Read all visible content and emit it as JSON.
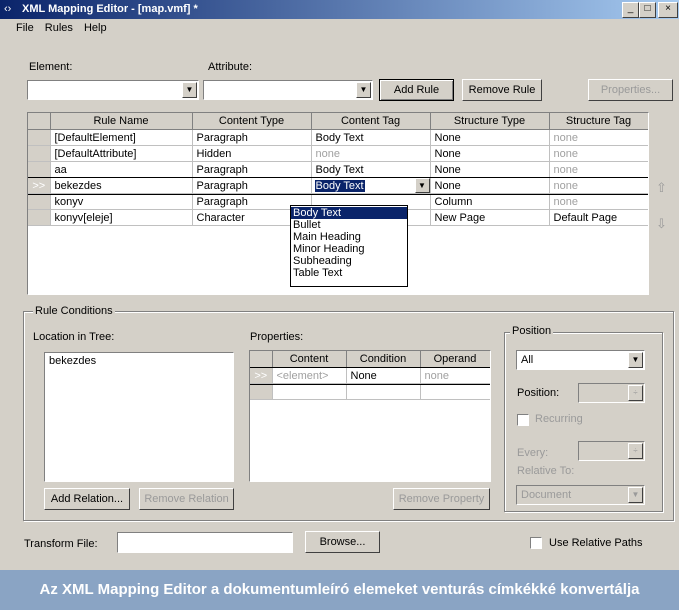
{
  "window": {
    "title": "XML Mapping Editor - [map.vmf] *",
    "minimize": "_",
    "maximize": "□",
    "close": "×"
  },
  "menu": {
    "items": [
      "File",
      "Rules",
      "Help"
    ]
  },
  "top": {
    "element_label": "Element:",
    "attribute_label": "Attribute:",
    "element_value": "",
    "attribute_value": "",
    "add_rule": "Add Rule",
    "remove_rule": "Remove Rule",
    "properties": "Properties..."
  },
  "rules_table": {
    "columns": [
      "Rule Name",
      "Content Type",
      "Content Tag",
      "Structure Type",
      "Structure Tag"
    ],
    "rows": [
      {
        "marker": "",
        "name": "[DefaultElement]",
        "content_type": "Paragraph",
        "content_tag": "Body Text",
        "structure_type": "None",
        "structure_tag": "none"
      },
      {
        "marker": "",
        "name": "[DefaultAttribute]",
        "content_type": "Hidden",
        "content_tag": "none",
        "structure_type": "None",
        "structure_tag": "none"
      },
      {
        "marker": "",
        "name": "aa",
        "content_type": "Paragraph",
        "content_tag": "Body Text",
        "structure_type": "None",
        "structure_tag": "none"
      },
      {
        "marker": ">>",
        "name": "bekezdes",
        "content_type": "Paragraph",
        "content_tag": "Body Text",
        "structure_type": "None",
        "structure_tag": "none"
      },
      {
        "marker": "",
        "name": "konyv",
        "content_type": "Paragraph",
        "content_tag": "",
        "structure_type": "Column",
        "structure_tag": "none"
      },
      {
        "marker": "",
        "name": "konyv[eleje]",
        "content_type": "Character",
        "content_tag": "",
        "structure_type": "New Page",
        "structure_tag": "Default Page"
      }
    ],
    "dropdown_options": [
      "Body Text",
      "Bullet",
      "Main Heading",
      "Minor Heading",
      "Subheading",
      "Table Text"
    ],
    "dropdown_selected": "Body Text"
  },
  "rule_conditions": {
    "label": "Rule Conditions",
    "location_label": "Location in Tree:",
    "location_items": [
      "bekezdes"
    ],
    "properties_label": "Properties:",
    "prop_columns": [
      "Content",
      "Condition",
      "Operand"
    ],
    "prop_rows": [
      {
        "marker": ">>",
        "content": "<element>",
        "condition": "None",
        "operand": "none"
      }
    ],
    "add_relation": "Add Relation...",
    "remove_relation": "Remove Relation",
    "remove_property": "Remove Property"
  },
  "position": {
    "label": "Position",
    "select_value": "All",
    "position_label": "Position:",
    "recurring_label": "Recurring",
    "every_label": "Every:",
    "relative_to_label": "Relative To:",
    "relative_to_value": "Document"
  },
  "bottom": {
    "transform_label": "Transform File:",
    "transform_value": "",
    "browse": "Browse...",
    "use_relative": "Use Relative Paths"
  },
  "caption": "Az XML Mapping Editor a dokumentumleíró elemeket venturás címkékké konvertálja"
}
